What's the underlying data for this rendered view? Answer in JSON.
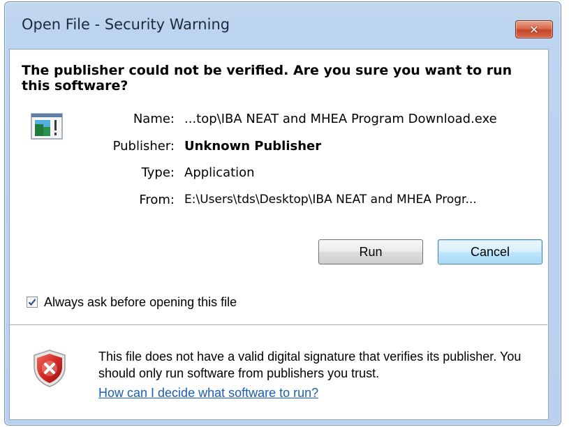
{
  "window": {
    "title": "Open File - Security Warning",
    "close_glyph": "✕"
  },
  "heading": "The publisher could not be verified.  Are you sure you want to run this software?",
  "file_info": {
    "name_label": "Name:",
    "name_value": "...top\\IBA NEAT and MHEA Program Download.exe",
    "publisher_label": "Publisher:",
    "publisher_value": "Unknown Publisher",
    "type_label": "Type:",
    "type_value": "Application",
    "from_label": "From:",
    "from_value": "E:\\Users\\tds\\Desktop\\IBA NEAT and MHEA Progr..."
  },
  "buttons": {
    "run": "Run",
    "cancel": "Cancel"
  },
  "always_ask": {
    "label": "Always ask before opening this file",
    "checked": true
  },
  "warning": {
    "text": "This file does not have a valid digital signature that verifies its publisher.  You should only run software from publishers you trust.",
    "link": "How can I decide what software to run?"
  },
  "icons": {
    "file": "application-file-icon",
    "shield": "security-shield-error-icon",
    "check": "checkmark-icon"
  },
  "colors": {
    "frame": "#b9d1ec",
    "close_button": "#c4452a",
    "link": "#1a5fb4",
    "shield_red": "#c8201b"
  }
}
